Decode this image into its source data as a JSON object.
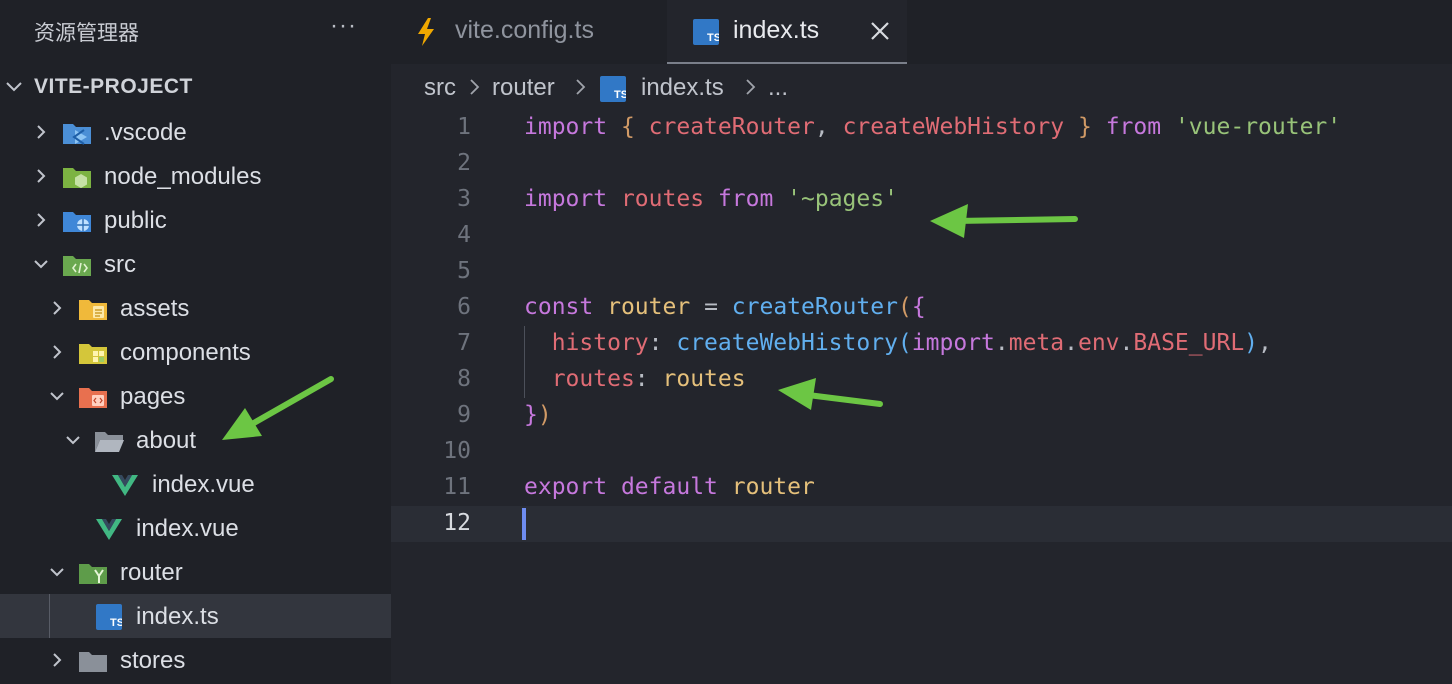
{
  "sidebar": {
    "title": "资源管理器",
    "more_label": "···",
    "project_name": "VITE-PROJECT",
    "items": [
      {
        "label": ".vscode"
      },
      {
        "label": "node_modules"
      },
      {
        "label": "public"
      },
      {
        "label": "src"
      },
      {
        "label": "assets"
      },
      {
        "label": "components"
      },
      {
        "label": "pages"
      },
      {
        "label": "about"
      },
      {
        "label": "index.vue"
      },
      {
        "label": "index.vue"
      },
      {
        "label": "router"
      },
      {
        "label": "index.ts"
      },
      {
        "label": "stores"
      }
    ]
  },
  "tabs": [
    {
      "label": "vite.config.ts"
    },
    {
      "label": "index.ts"
    }
  ],
  "breadcrumb": {
    "items": [
      "src",
      "router",
      "index.ts",
      "..."
    ]
  },
  "editor": {
    "line_numbers": [
      "1",
      "2",
      "3",
      "4",
      "5",
      "6",
      "7",
      "8",
      "9",
      "10",
      "11",
      "12"
    ],
    "current_line": 12
  },
  "colors": {
    "accent_arrow": "#6cc644",
    "keyword": "#c678dd",
    "string": "#98c379",
    "function": "#61afef"
  }
}
